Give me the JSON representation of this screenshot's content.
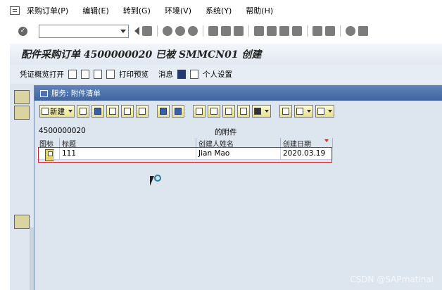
{
  "menubar": {
    "items": [
      "采购订单(P)",
      "编辑(E)",
      "转到(G)",
      "环境(V)",
      "系统(Y)",
      "帮助(H)"
    ]
  },
  "systoolbar": {
    "command_value": ""
  },
  "title": {
    "text": "配件采购订单 4500000020 已被 SMMCN01 创建"
  },
  "apptoolbar": {
    "voucher_overview": "凭证概览打开",
    "print_preview": "打印预览",
    "messages": "消息",
    "personal_settings": "个人设置"
  },
  "popup": {
    "title": "服务: 附件清单",
    "toolbar": {
      "new_label": "新建"
    },
    "doc_number": "4500000020",
    "doc_suffix": "的附件",
    "columns": [
      "图标",
      "标题",
      "创建人姓名",
      "创建日期"
    ],
    "rows": [
      {
        "title": "111",
        "creator": "Jian Mao",
        "date": "2020.03.19"
      }
    ]
  },
  "watermark": "CSDN @SAPmatinal",
  "colors": {
    "title_bar": "#4a6fab",
    "highlight_border": "#d21f1f",
    "button_face": "#f4eeb0"
  }
}
